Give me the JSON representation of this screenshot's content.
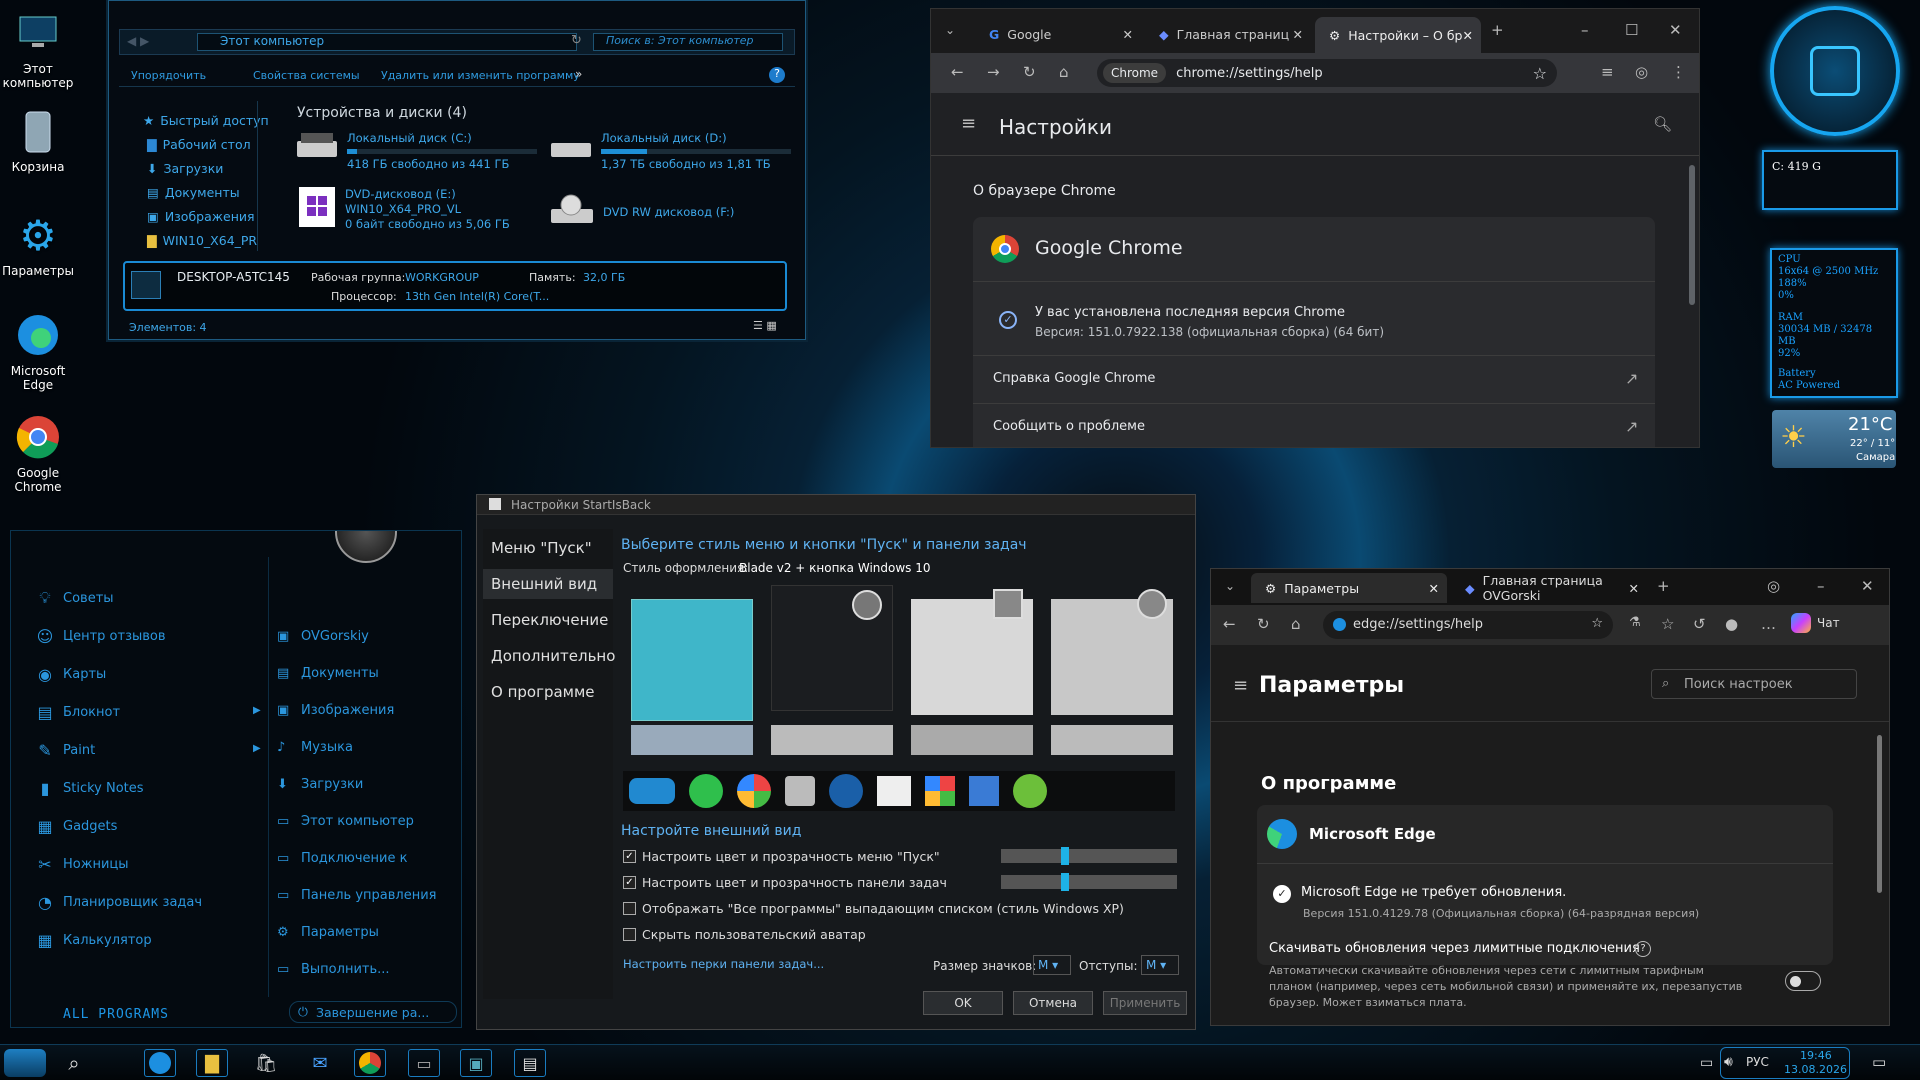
{
  "desktop_icons": [
    {
      "label": "Этот\nкомпьютер"
    },
    {
      "label": "Корзина"
    },
    {
      "label": "Параметры"
    },
    {
      "label": "Microsoft\nEdge"
    },
    {
      "label": "Google\nChrome"
    }
  ],
  "explorer": {
    "address": "Этот компьютер",
    "search_placeholder": "Поиск в: Этот компьютер",
    "toolbar": [
      "Упорядочить",
      "Свойства системы",
      "Удалить или изменить программу"
    ],
    "nav": [
      "Быстрый доступ",
      "Рабочий стол",
      "Загрузки",
      "Документы",
      "Изображения",
      "WIN10_X64_PR"
    ],
    "section_title": "Устройства и диски (4)",
    "drives": [
      {
        "name": "Локальный диск (C:)",
        "free": "418 ГБ свободно из 441 ГБ",
        "used_fraction": 0.05
      },
      {
        "name": "Локальный диск (D:)",
        "free": "1,37 ТБ свободно из 1,81 ТБ",
        "used_fraction": 0.24
      },
      {
        "name": "DVD-дисковод (E:)",
        "sub": "WIN10_X64_PRO_VL",
        "free": "0 байт свободно из 5,06 ГБ"
      },
      {
        "name": "DVD RW дисковод (F:)"
      }
    ],
    "details": {
      "computer": "DESKTOP-A5TC145",
      "workgroup_label": "Рабочая группа:",
      "workgroup": "WORKGROUP",
      "memory_label": "Память:",
      "memory": "32,0 ГБ",
      "cpu_label": "Процессор:",
      "cpu": "13th Gen Intel(R) Core(T..."
    },
    "status": "Элементов: 4"
  },
  "chrome": {
    "tabs": [
      "Google",
      "Главная страниц",
      "Настройки – О бр"
    ],
    "omnibox_chip": "Chrome",
    "url": "chrome://settings/help",
    "settings_title": "Настройки",
    "about_heading": "О браузере Chrome",
    "product": "Google Chrome",
    "status": "У вас установлена последняя версия Chrome",
    "version": "Версия: 151.0.7922.138 (официальная сборка) (64 бит)",
    "help": "Справка Google Chrome",
    "report": "Сообщить о проблеме"
  },
  "start_menu": {
    "left": [
      "Советы",
      "Центр отзывов",
      "Карты",
      "Блокнот",
      "Paint",
      "Sticky Notes",
      "Gadgets",
      "Ножницы",
      "Планировщик задач",
      "Калькулятор"
    ],
    "right": [
      "OVGorskiy",
      "Документы",
      "Изображения",
      "Музыка",
      "Загрузки",
      "Этот компьютер",
      "Подключение к",
      "Панель управления",
      "Параметры",
      "Выполнить..."
    ],
    "all_programs": "ALL PROGRAMS",
    "shutdown": "Завершение ра..."
  },
  "sib": {
    "title": "Настройки StartIsBack",
    "nav": [
      "Меню \"Пуск\"",
      "Внешний вид",
      "Переключение",
      "Дополнительно",
      "О программе"
    ],
    "heading": "Выберите стиль меню и кнопки \"Пуск\" и панели задач",
    "style_label": "Стиль оформления:",
    "style_value": "Blade v2 + кнопка Windows 10",
    "appearance_heading": "Настройте внешний вид",
    "checks": [
      {
        "label": "Настроить цвет и прозрачность меню \"Пуск\"",
        "checked": true
      },
      {
        "label": "Настроить цвет и прозрачность панели задач",
        "checked": true
      },
      {
        "label": "Отображать \"Все программы\" выпадающим списком (стиль Windows XP)",
        "checked": false
      },
      {
        "label": "Скрыть пользовательский аватар",
        "checked": false
      }
    ],
    "link": "Настроить перки панели задач...",
    "icon_size_label": "Размер значков:",
    "icon_size": "M",
    "padding_label": "Отступы:",
    "padding": "M",
    "ok": "OK",
    "cancel": "Отмена",
    "apply": "Применить"
  },
  "edge": {
    "tabs": [
      "Параметры",
      "Главная страница OVGorski"
    ],
    "url": "edge://settings/help",
    "chat": "Чат",
    "title": "Параметры",
    "search_placeholder": "Поиск настроек",
    "about": "О программе",
    "product": "Microsoft Edge",
    "status": "Microsoft Edge не требует обновления.",
    "version": "Версия 151.0.4129.78 (Официальная сборка) (64-разрядная версия)",
    "metered_title": "Скачивать обновления через лимитные подключения",
    "metered_desc": "Автоматически скачивайте обновления через сети с лимитным тарифным планом (например, через сеть мобильной связи) и применяйте их, перезапустив браузер. Может взиматься плата."
  },
  "gadgets": {
    "drive": "C: 419 G",
    "cpu_lines": [
      "CPU",
      "16x64 @ 2500 MHz",
      "188%",
      "0%"
    ],
    "ram_lines": [
      "RAM",
      "30034 MB / 32478 MB",
      "92%"
    ],
    "battery_lines": [
      "Battery",
      "AC Powered"
    ],
    "weather_temp": "21°C",
    "weather_range": "22° / 11°",
    "weather_city": "Самара"
  },
  "taskbar": {
    "lang": "РУС",
    "time": "19:46",
    "date": "13.08.2026"
  }
}
